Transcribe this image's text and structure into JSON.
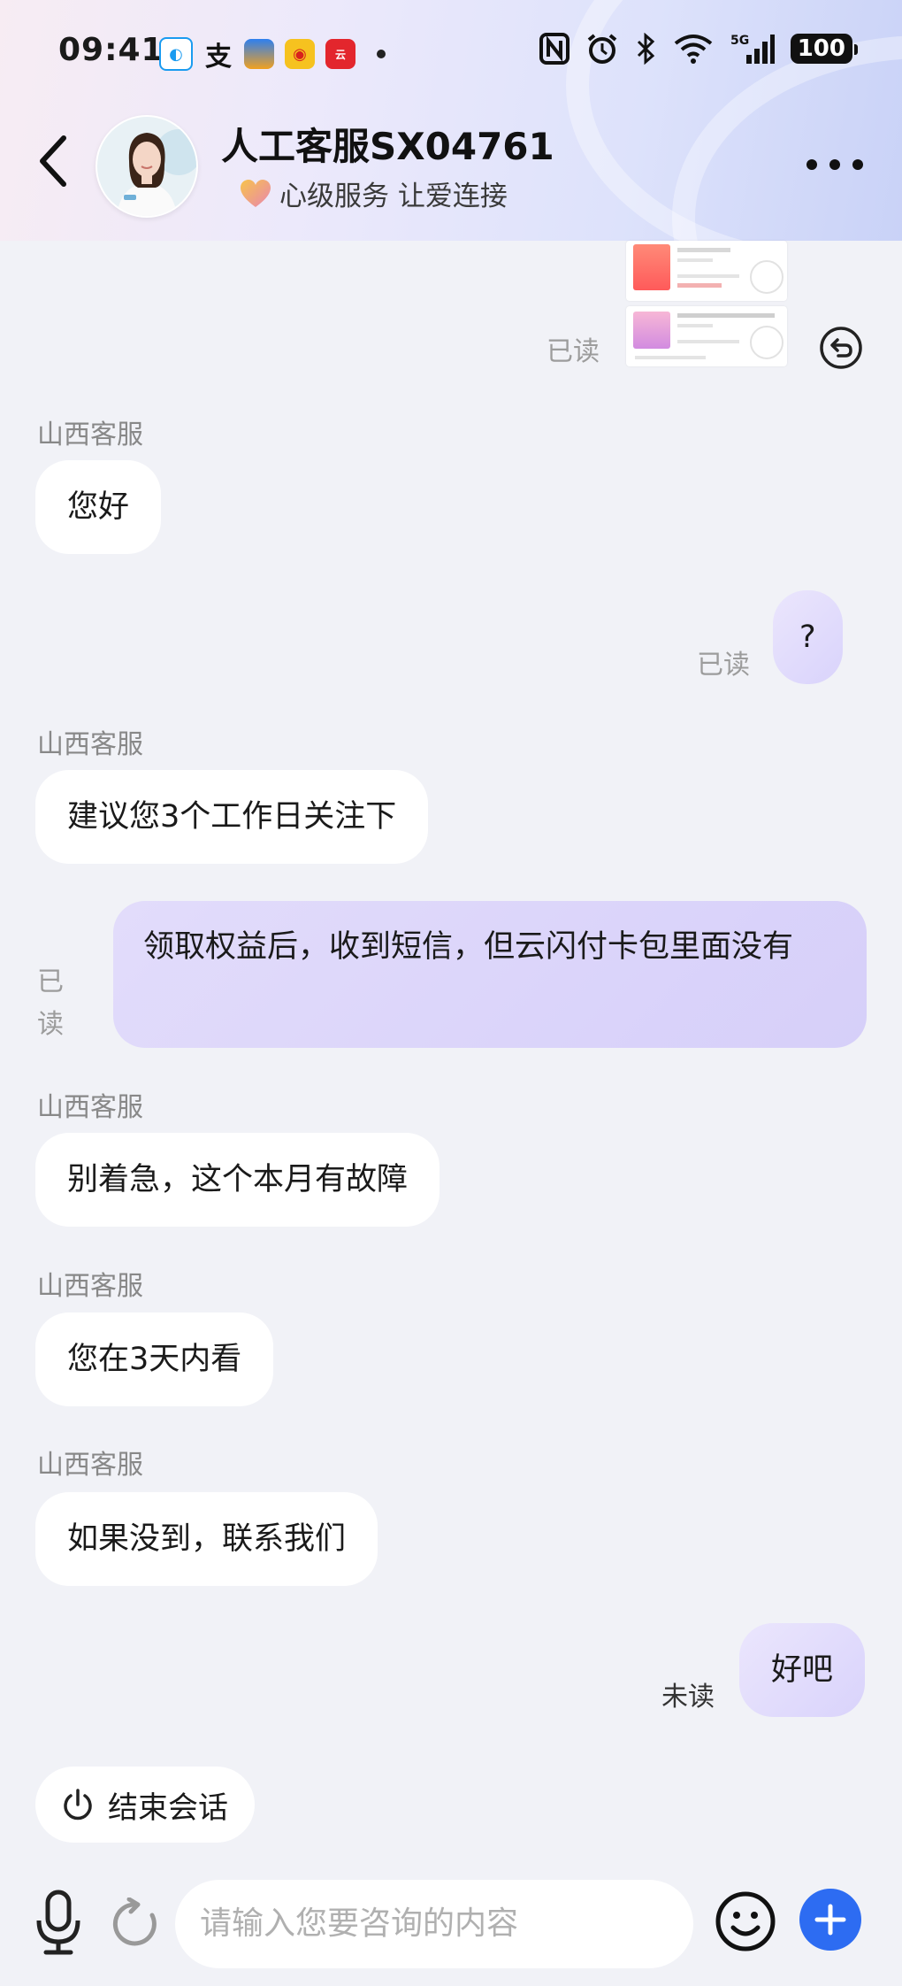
{
  "status_bar": {
    "time": "09:41",
    "battery": "100",
    "network": "5G"
  },
  "header": {
    "title": "人工客服SX04761",
    "subtitle": "心级服务 让爱连接"
  },
  "messages": {
    "m0_read": "已读",
    "m1_sender": "山西客服",
    "m1_text": "您好",
    "m2_text": "?",
    "m2_read": "已读",
    "m3_sender": "山西客服",
    "m3_text": "建议您3个工作日关注下",
    "m4_text": "领取权益后，收到短信，但云闪付卡包里面没有",
    "m4_read": "已读",
    "m5_sender": "山西客服",
    "m5_text": "别着急，这个本月有故障",
    "m6_sender": "山西客服",
    "m6_text": "您在3天内看",
    "m7_sender": "山西客服",
    "m7_text": "如果没到，联系我们",
    "m8_text": "好吧",
    "m8_status": "未读"
  },
  "end_session": {
    "label": "结束会话"
  },
  "input": {
    "placeholder": "请输入您要咨询的内容"
  },
  "colors": {
    "accent": "#2d6cf2",
    "bubble_out": "#ddd6fb",
    "bg": "#f1f2f7"
  }
}
